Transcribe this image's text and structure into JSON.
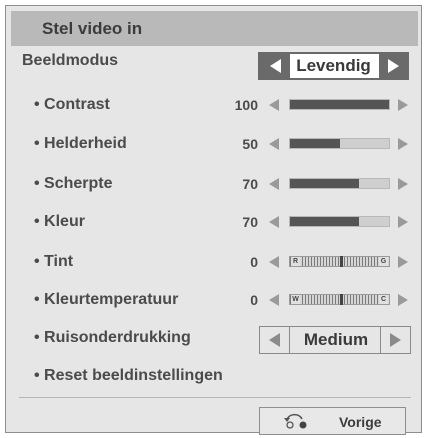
{
  "title": "Stel video in",
  "picture_mode": {
    "label": "Beeldmodus",
    "value": "Levendig"
  },
  "sliders": [
    {
      "label": "• Contrast",
      "value": "100",
      "level": 1.0
    },
    {
      "label": "• Helderheid",
      "value": "50",
      "level": 0.5
    },
    {
      "label": "• Scherpte",
      "value": "70",
      "level": 0.7
    },
    {
      "label": "• Kleur",
      "value": "70",
      "level": 0.7
    }
  ],
  "balance": [
    {
      "label": "• Tint",
      "value": "0",
      "left_tag": "R",
      "right_tag": "G"
    },
    {
      "label": "• Kleurtemperatuur",
      "value": "0",
      "left_tag": "W",
      "right_tag": "C"
    }
  ],
  "noise_reduction": {
    "label": "• Ruisonderdrukking",
    "value": "Medium"
  },
  "reset_label": "• Reset beeldinstellingen",
  "back_label": "Vorige"
}
